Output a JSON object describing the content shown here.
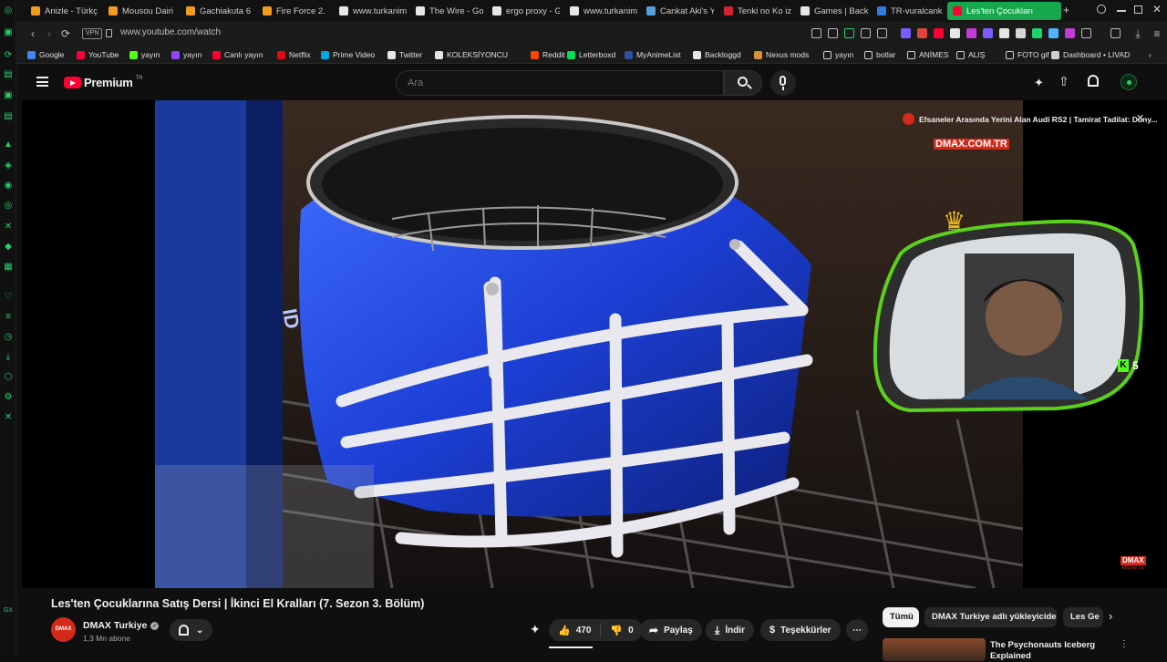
{
  "colors": {
    "gx_accent": "#20d46b",
    "yt_red": "#ff0033",
    "tab_active": "#17a84b",
    "page_bg": "#0f0f0f"
  },
  "sidebar": {
    "icons": [
      "opera-gx-logo-icon",
      "messenger-icon",
      "refresh-icon",
      "gx-control-icon",
      "whatsapp-icon",
      "mail-icon",
      "music-icon",
      "twitch-icon",
      "whatsapp-icon",
      "instagram-icon",
      "x-icon",
      "discord-icon",
      "grid-icon",
      "heart-icon",
      "history-icon",
      "clock-icon",
      "download-icon",
      "extensions-icon",
      "settings-icon",
      "gx-link-icon",
      "gx-label-icon"
    ]
  },
  "tabs": [
    {
      "label": "Anizle - Türkç",
      "favicon_color": "#f29c1f"
    },
    {
      "label": "Mousou Dairi",
      "favicon_color": "#f29c1f"
    },
    {
      "label": "Gachiakuta 6",
      "favicon_color": "#f29c1f"
    },
    {
      "label": "Fire Force 2.",
      "favicon_color": "#f29c1f"
    },
    {
      "label": "www.turkanim",
      "favicon_color": "#e6e6e6"
    },
    {
      "label": "The Wire - Go",
      "favicon_color": "#e6e6e6"
    },
    {
      "label": "ergo proxy - G",
      "favicon_color": "#e6e6e6"
    },
    {
      "label": "www.turkanim",
      "favicon_color": "#e6e6e6"
    },
    {
      "label": "Cankat Aki's Y",
      "favicon_color": "#5aa0d8"
    },
    {
      "label": "Tenki no Ko iz",
      "favicon_color": "#d3232f"
    },
    {
      "label": "Games | Back",
      "favicon_color": "#e6e6e6"
    },
    {
      "label": "TR-vuralcank",
      "favicon_color": "#2f7be0"
    },
    {
      "label": "Les'ten Çocukları",
      "favicon_color": "#ff0033"
    }
  ],
  "tab_controls": {
    "new_tab": "+"
  },
  "address": {
    "vpn": "VPN",
    "url": "www.youtube.com/watch"
  },
  "bookmarks": [
    {
      "label": "Google",
      "color": "#4285f4"
    },
    {
      "label": "YouTube",
      "color": "#ff0033"
    },
    {
      "label": "yayın",
      "color": "#53fc18"
    },
    {
      "label": "yayın",
      "color": "#9146ff"
    },
    {
      "label": "Canlı yayın",
      "color": "#ff0033"
    },
    {
      "label": "Netflix",
      "color": "#e50914"
    },
    {
      "label": "Prime Video",
      "color": "#00a8e1"
    },
    {
      "label": "Twitter",
      "color": "#e6e6e6"
    },
    {
      "label": "KOLEKSİYONCU",
      "color": "#e6e6e6"
    },
    {
      "label": "Reddit",
      "color": "#ff4500"
    },
    {
      "label": "Letterboxd",
      "color": "#00e054"
    },
    {
      "label": "MyAnimeList",
      "color": "#2e51a2"
    },
    {
      "label": "Backloggd",
      "color": "#e6e6e6"
    },
    {
      "label": "Nexus mods",
      "color": "#da8e35"
    },
    {
      "label": "yayın",
      "color": "#cfcfcf"
    },
    {
      "label": "botlar",
      "color": "#cfcfcf"
    },
    {
      "label": "ANİMES",
      "color": "#cfcfcf"
    },
    {
      "label": "ALIŞ",
      "color": "#cfcfcf"
    },
    {
      "label": "FOTO gif",
      "color": "#cfcfcf"
    },
    {
      "label": "Dashboard • LIVAD",
      "color": "#cfcfcf"
    }
  ],
  "youtube": {
    "logo_text": "Premium",
    "logo_region": "TR",
    "search_placeholder": "Ara"
  },
  "player": {
    "overlay_title": "Efsaneler Arasında Yerini Alan Audi RS2 | Tamirat Tadilat: Düny...",
    "watermark_top": "DMAX.COM.TR",
    "watermark_bottom_top": "DMAX",
    "watermark_bottom_sub": "ABONE OL",
    "kick_count": "5"
  },
  "video": {
    "title": "Les'ten Çocuklarına Satış Dersi | İkinci El Kralları (7. Sezon 3. Bölüm)",
    "channel_avatar": "DMAX",
    "channel": "DMAX Turkiye",
    "subscribers": "1,3 Mn abone",
    "likes": "470",
    "dislikes": "0",
    "share": "Paylaş",
    "download": "İndir",
    "thanks": "Teşekkürler",
    "more": "⋯"
  },
  "chips": [
    "Tümü",
    "DMAX Turkiye adlı yükleyiciden",
    "Les Ge"
  ],
  "recommendation": {
    "title_line1": "The Psychonauts Iceberg",
    "title_line2": "Explained"
  }
}
